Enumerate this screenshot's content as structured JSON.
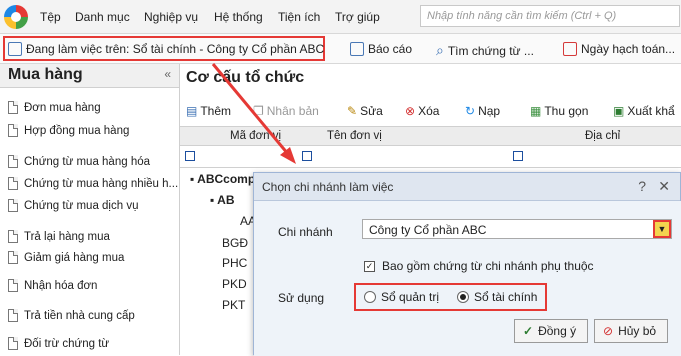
{
  "menu": [
    "Tệp",
    "Danh mục",
    "Nghiệp vụ",
    "Hệ thống",
    "Tiện ích",
    "Trợ giúp"
  ],
  "search": {
    "placeholder": "Nhập tính năng cần tìm kiếm (Ctrl + Q)"
  },
  "toolbar": {
    "work_label": "Đang làm việc trên: Sổ tài chính - Công ty Cổ phần ABC",
    "report": "Báo cáo",
    "find": "Tìm chứng từ ...",
    "posting_date": "Ngày hạch toán..."
  },
  "left": {
    "title": "Mua hàng",
    "collapse": "«",
    "items": [
      "Đơn mua hàng",
      "Hợp đồng mua hàng",
      "Chứng từ mua hàng hóa",
      "Chứng từ mua hàng nhiều h...",
      "Chứng từ mua dịch vụ",
      "Trả lại hàng mua",
      "Giảm giá hàng mua",
      "Nhận hóa đơn",
      "Trả tiền nhà cung cấp",
      "Đối trừ chứng từ"
    ]
  },
  "main": {
    "title": "Cơ cấu tổ chức",
    "actions": [
      "Thêm",
      "Nhân bản",
      "Sửa",
      "Xóa",
      "Nạp",
      "Thu gọn",
      "Xuất khẩ"
    ],
    "columns": [
      "Mã đơn vị",
      "Tên đơn vị",
      "Địa chỉ"
    ],
    "tree": [
      "ABCcomp",
      "AB",
      "AA",
      "BGĐ",
      "PHC",
      "PKD",
      "PKT"
    ]
  },
  "dialog": {
    "title": "Chọn chi nhánh làm việc",
    "help": "?",
    "close": "✕",
    "branch_label": "Chi nhánh",
    "branch_value": "Công ty Cổ phần ABC",
    "include_label": "Bao gồm chứng từ chi nhánh phụ thuộc",
    "include_checked": true,
    "use_label": "Sử dụng",
    "option_manage": "Sổ quản trị",
    "option_finance": "Sổ tài chính",
    "selected": "Sổ tài chính",
    "ok": "Đồng ý",
    "cancel": "Hủy bỏ"
  },
  "colors": {
    "highlight": "#e53935",
    "dialog_bg": "#eef3f9",
    "title_bar": "#dfe6f0"
  }
}
